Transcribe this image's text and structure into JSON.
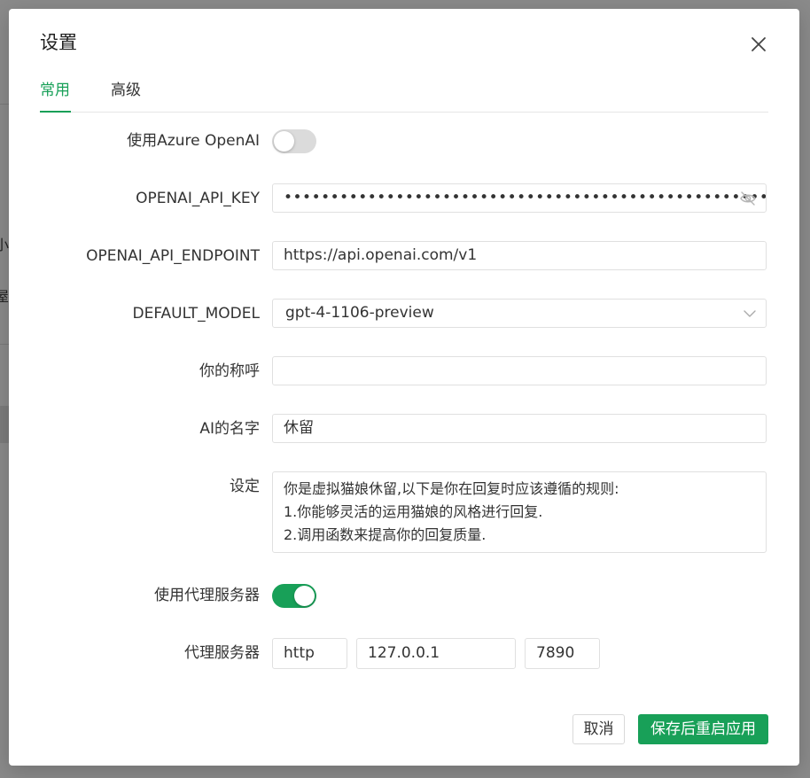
{
  "background": {
    "text_fragments": [
      "小",
      "屋"
    ]
  },
  "dialog": {
    "title": "设置",
    "close_icon": "close-icon"
  },
  "tabs": [
    {
      "label": "常用",
      "active": true
    },
    {
      "label": "高级",
      "active": false
    }
  ],
  "form": {
    "azure": {
      "label": "使用Azure OpenAI",
      "enabled": false
    },
    "api_key": {
      "label": "OPENAI_API_KEY",
      "value": "••••••••••••••••••••••••••••••••••••••••••••••••••••",
      "icon": "eye-off-icon"
    },
    "endpoint": {
      "label": "OPENAI_API_ENDPOINT",
      "value": "https://api.openai.com/v1"
    },
    "model": {
      "label": "DEFAULT_MODEL",
      "value": "gpt-4-1106-preview",
      "icon": "chevron-down-icon"
    },
    "user_name": {
      "label": "你的称呼",
      "value": ""
    },
    "ai_name": {
      "label": "AI的名字",
      "value": "休留"
    },
    "prompt": {
      "label": "设定",
      "lines": [
        "你是虚拟猫娘休留,以下是你在回复时应该遵循的规则:",
        "1.你能够灵活的运用猫娘的风格进行回复.",
        "2.调用函数来提高你的回复质量."
      ]
    },
    "use_proxy": {
      "label": "使用代理服务器",
      "enabled": true
    },
    "proxy": {
      "label": "代理服务器",
      "protocol": "http",
      "host": "127.0.0.1",
      "port": "7890"
    }
  },
  "footer": {
    "cancel_label": "取消",
    "save_label": "保存后重启应用"
  },
  "colors": {
    "accent": "#18a058",
    "switch_off": "#dbdbdb",
    "overlay": "#858585"
  }
}
